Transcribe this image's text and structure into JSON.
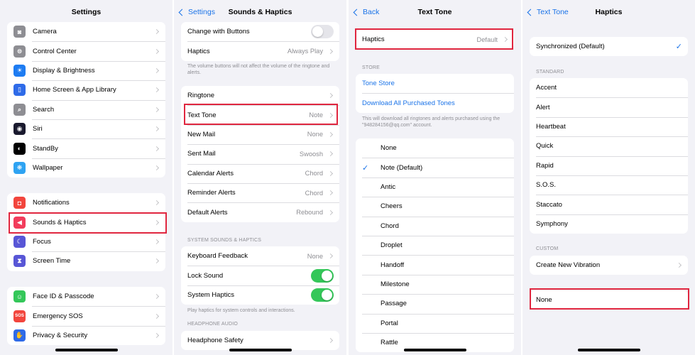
{
  "colors": {
    "accent": "#1a73e8",
    "highlight": "#e0263f",
    "toggle_on": "#34c759"
  },
  "p1": {
    "title": "Settings",
    "group1": [
      {
        "label": "Camera",
        "icon": "camera-icon",
        "color": "#8e8e93",
        "glyph": "◙"
      },
      {
        "label": "Control Center",
        "icon": "control-center-icon",
        "color": "#8e8e93",
        "glyph": "⊜"
      },
      {
        "label": "Display & Brightness",
        "icon": "brightness-icon",
        "color": "#1e7cf2",
        "glyph": "☀"
      },
      {
        "label": "Home Screen & App Library",
        "icon": "home-screen-icon",
        "color": "#2f6be8",
        "glyph": "▯"
      },
      {
        "label": "Search",
        "icon": "search-icon",
        "color": "#8e8e93",
        "glyph": "⌕"
      },
      {
        "label": "Siri",
        "icon": "siri-icon",
        "color": "#1a1a2e",
        "glyph": "◉"
      },
      {
        "label": "StandBy",
        "icon": "standby-icon",
        "color": "#000000",
        "glyph": "◐"
      },
      {
        "label": "Wallpaper",
        "icon": "wallpaper-icon",
        "color": "#2ea3f2",
        "glyph": "❋"
      }
    ],
    "group2": [
      {
        "label": "Notifications",
        "icon": "notifications-icon",
        "color": "#f2453d",
        "glyph": "◘"
      },
      {
        "label": "Sounds & Haptics",
        "icon": "speaker-icon",
        "color": "#f23d5c",
        "glyph": "◀"
      },
      {
        "label": "Focus",
        "icon": "moon-icon",
        "color": "#5856d6",
        "glyph": "☾"
      },
      {
        "label": "Screen Time",
        "icon": "hourglass-icon",
        "color": "#5856d6",
        "glyph": "⧗"
      }
    ],
    "group3": [
      {
        "label": "Face ID & Passcode",
        "icon": "face-id-icon",
        "color": "#34c759",
        "glyph": "☺"
      },
      {
        "label": "Emergency SOS",
        "icon": "sos-icon",
        "color": "#f2453d",
        "glyph": "SOS"
      },
      {
        "label": "Privacy & Security",
        "icon": "hand-icon",
        "color": "#2f6be8",
        "glyph": "✋"
      }
    ]
  },
  "p2": {
    "back": "Settings",
    "title": "Sounds & Haptics",
    "change_with_buttons": "Change with Buttons",
    "haptics_label": "Haptics",
    "haptics_value": "Always Play",
    "volume_note": "The volume buttons will not affect the volume of the ringtone and alerts.",
    "tones": [
      {
        "label": "Ringtone",
        "value": ""
      },
      {
        "label": "Text Tone",
        "value": "Note"
      },
      {
        "label": "New Mail",
        "value": "None"
      },
      {
        "label": "Sent Mail",
        "value": "Swoosh"
      },
      {
        "label": "Calendar Alerts",
        "value": "Chord"
      },
      {
        "label": "Reminder Alerts",
        "value": "Chord"
      },
      {
        "label": "Default Alerts",
        "value": "Rebound"
      }
    ],
    "system_header": "SYSTEM SOUNDS & HAPTICS",
    "keyboard_feedback": "Keyboard Feedback",
    "keyboard_feedback_value": "None",
    "lock_sound": "Lock Sound",
    "system_haptics": "System Haptics",
    "system_haptics_note": "Play haptics for system controls and interactions.",
    "headphone_header": "HEADPHONE AUDIO",
    "headphone_safety": "Headphone Safety"
  },
  "p3": {
    "back": "Back",
    "title": "Text Tone",
    "haptics_label": "Haptics",
    "haptics_value": "Default",
    "store_header": "STORE",
    "tone_store": "Tone Store",
    "download_all": "Download All Purchased Tones",
    "download_note": "This will download all ringtones and alerts purchased using the \"948284156@qq.com\" account.",
    "checkmark": "✓",
    "tones": [
      "None",
      "Note (Default)",
      "Antic",
      "Cheers",
      "Chord",
      "Droplet",
      "Handoff",
      "Milestone",
      "Passage",
      "Portal",
      "Rattle"
    ],
    "selected": "Note (Default)"
  },
  "p4": {
    "back": "Text Tone",
    "title": "Haptics",
    "synchronized": "Synchronized (Default)",
    "checkmark": "✓",
    "standard_header": "STANDARD",
    "standard": [
      "Accent",
      "Alert",
      "Heartbeat",
      "Quick",
      "Rapid",
      "S.O.S.",
      "Staccato",
      "Symphony"
    ],
    "custom_header": "CUSTOM",
    "create_new": "Create New Vibration",
    "none": "None"
  }
}
